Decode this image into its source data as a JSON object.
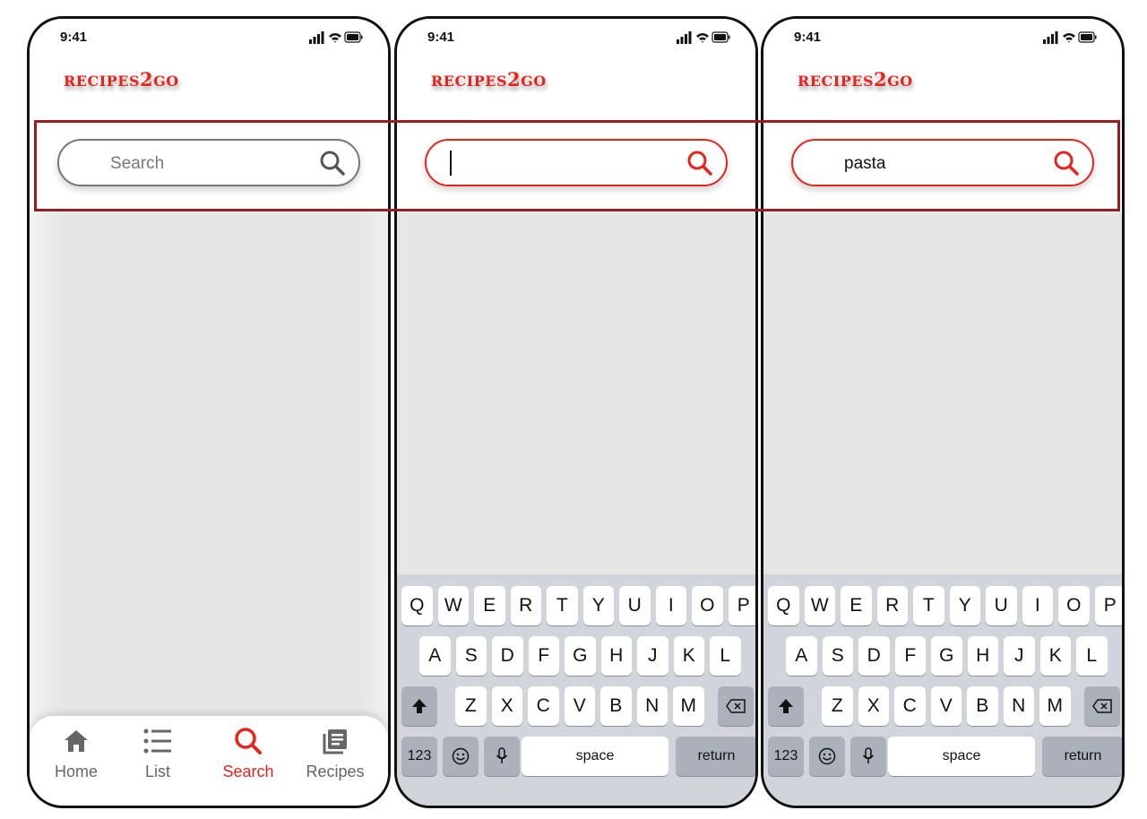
{
  "status": {
    "time": "9:41"
  },
  "logo": {
    "part1": "RECIPES",
    "part2": "2",
    "part3": "GO"
  },
  "screens": [
    {
      "search_placeholder": "Search",
      "search_value": ""
    },
    {
      "search_placeholder": "",
      "search_value": ""
    },
    {
      "search_placeholder": "",
      "search_value": "pasta"
    }
  ],
  "tabbar": {
    "tabs": [
      {
        "label": "Home",
        "icon": "home-icon",
        "active": false
      },
      {
        "label": "List",
        "icon": "list-icon",
        "active": false
      },
      {
        "label": "Search",
        "icon": "search-icon",
        "active": true
      },
      {
        "label": "Recipes",
        "icon": "recipes-icon",
        "active": false
      }
    ]
  },
  "keyboard": {
    "row1": [
      "Q",
      "W",
      "E",
      "R",
      "T",
      "Y",
      "U",
      "I",
      "O",
      "P"
    ],
    "row2": [
      "A",
      "S",
      "D",
      "F",
      "G",
      "H",
      "J",
      "K",
      "L"
    ],
    "row3": [
      "Z",
      "X",
      "C",
      "V",
      "B",
      "N",
      "M"
    ],
    "numbers_label": "123",
    "space_label": "space",
    "return_label": "return"
  },
  "colors": {
    "accent": "#e8231a",
    "highlight_frame": "#9b1c1c",
    "keyboard_bg": "#d1d4db"
  }
}
